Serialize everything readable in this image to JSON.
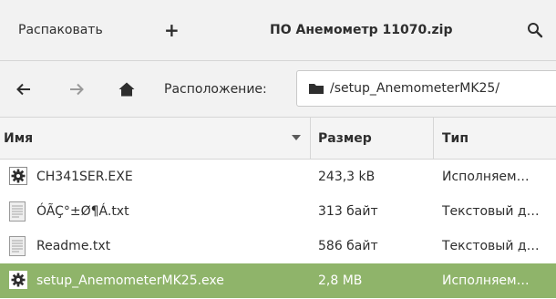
{
  "header": {
    "extract_label": "Распаковать",
    "add_label": "+",
    "title": "ПО Анемометр 11070.zip"
  },
  "locationbar": {
    "label": "Расположение:",
    "path": "/setup_AnemometerMK25/"
  },
  "columns": {
    "name": "Имя",
    "size": "Размер",
    "type": "Тип"
  },
  "files": [
    {
      "name": "CH341SER.EXE",
      "size": "243,3 kB",
      "type": "Исполняем…",
      "icon": "executable-icon",
      "selected": false
    },
    {
      "name": "ÓÃÇ°±Ø¶Á.txt",
      "size": "313 байт",
      "type": "Текстовый д…",
      "icon": "text-file-icon",
      "selected": false
    },
    {
      "name": "Readme.txt",
      "size": "586 байт",
      "type": "Текстовый д…",
      "icon": "text-file-icon",
      "selected": false
    },
    {
      "name": "setup_AnemometerMK25.exe",
      "size": "2,8 MB",
      "type": "Исполняем…",
      "icon": "executable-icon",
      "selected": true
    }
  ],
  "colors": {
    "selection": "#8fb46a",
    "toolbar_bg": "#f2f2f2"
  }
}
